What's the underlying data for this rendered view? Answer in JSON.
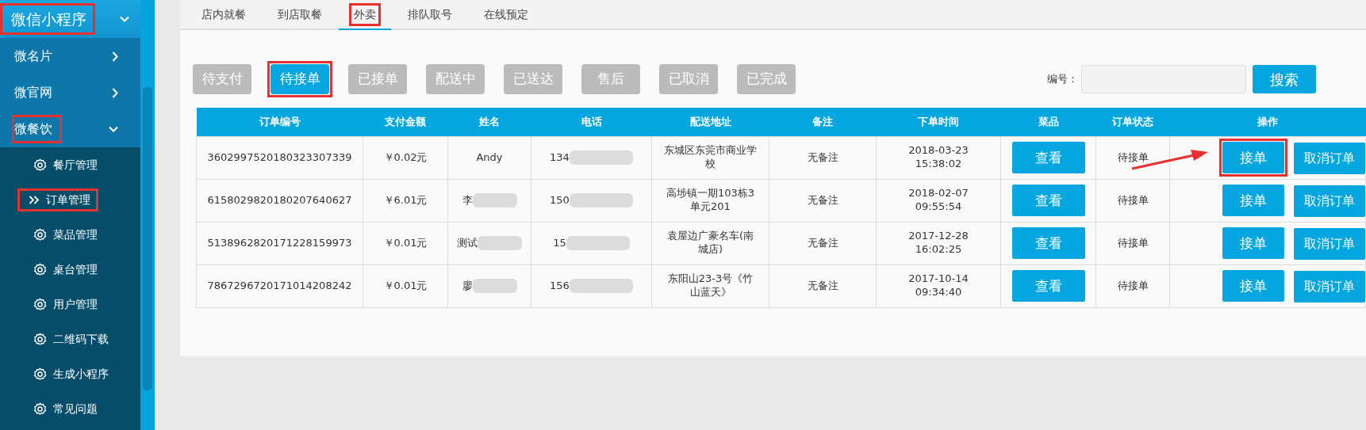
{
  "sidebar": {
    "header": {
      "label": "微信小程序",
      "highlighted": true
    },
    "items": [
      {
        "label": "微名片",
        "expanded": false,
        "highlighted": false
      },
      {
        "label": "微官网",
        "expanded": false,
        "highlighted": false
      },
      {
        "label": "微餐饮",
        "expanded": true,
        "highlighted": true,
        "children": [
          {
            "label": "餐厅管理",
            "selected": false,
            "highlighted": false
          },
          {
            "label": "订单管理",
            "selected": true,
            "highlighted": true
          },
          {
            "label": "菜品管理",
            "selected": false,
            "highlighted": false
          },
          {
            "label": "桌台管理",
            "selected": false,
            "highlighted": false
          },
          {
            "label": "用户管理",
            "selected": false,
            "highlighted": false
          },
          {
            "label": "二维码下载",
            "selected": false,
            "highlighted": false
          },
          {
            "label": "生成小程序",
            "selected": false,
            "highlighted": false
          },
          {
            "label": "常见问题",
            "selected": false,
            "highlighted": false
          }
        ]
      }
    ]
  },
  "tabs": [
    {
      "label": "店内就餐",
      "selected": false,
      "highlighted": false
    },
    {
      "label": "到店取餐",
      "selected": false,
      "highlighted": false
    },
    {
      "label": "外卖",
      "selected": true,
      "highlighted": true
    },
    {
      "label": "排队取号",
      "selected": false,
      "highlighted": false
    },
    {
      "label": "在线预定",
      "selected": false,
      "highlighted": false
    }
  ],
  "filters": [
    {
      "label": "待支付",
      "selected": false,
      "highlighted": false
    },
    {
      "label": "待接单",
      "selected": true,
      "highlighted": true
    },
    {
      "label": "已接单",
      "selected": false,
      "highlighted": false
    },
    {
      "label": "配送中",
      "selected": false,
      "highlighted": false
    },
    {
      "label": "已送达",
      "selected": false,
      "highlighted": false
    },
    {
      "label": "售后",
      "selected": false,
      "highlighted": false
    },
    {
      "label": "已取消",
      "selected": false,
      "highlighted": false
    },
    {
      "label": "已完成",
      "selected": false,
      "highlighted": false
    }
  ],
  "search": {
    "label": "编号：",
    "button": "搜索"
  },
  "table": {
    "columns": [
      "订单编号",
      "支付金额",
      "姓名",
      "电话",
      "配送地址",
      "备注",
      "下单时间",
      "菜品",
      "订单状态",
      "操作"
    ],
    "rows": [
      {
        "order_no": "3602997520180323307339",
        "amount": "￥0.02元",
        "name": "Andy",
        "name_redacted": false,
        "phone": "134",
        "phone_redacted": true,
        "address": "东城区东莞市商业学校",
        "note": "无备注",
        "date": "2018-03-23",
        "time": "15:38:02",
        "view_button": "查看",
        "status": "待接单",
        "accept_button": "接单",
        "accept_highlighted": true,
        "cancel_button": "取消订单",
        "pointer_arrow": true
      },
      {
        "order_no": "6158029820180207640627",
        "amount": "￥6.01元",
        "name": "李",
        "name_redacted": true,
        "phone": "150",
        "phone_redacted": true,
        "address": "高埗镇一期103栋3单元201",
        "note": "无备注",
        "date": "2018-02-07",
        "time": "09:55:54",
        "view_button": "查看",
        "status": "待接单",
        "accept_button": "接单",
        "accept_highlighted": false,
        "cancel_button": "取消订单",
        "pointer_arrow": false
      },
      {
        "order_no": "5138962820171228159973",
        "amount": "￥0.01元",
        "name": "测试",
        "name_redacted": true,
        "phone": "15",
        "phone_redacted": true,
        "address": "袁屋边广豪名车(南城店)",
        "note": "无备注",
        "date": "2017-12-28",
        "time": "16:02:25",
        "view_button": "查看",
        "status": "待接单",
        "accept_button": "接单",
        "accept_highlighted": false,
        "cancel_button": "取消订单",
        "pointer_arrow": false
      },
      {
        "order_no": "7867296720171014208242",
        "amount": "￥0.01元",
        "name": "廖",
        "name_redacted": true,
        "phone": "156",
        "phone_redacted": true,
        "address": "东阳山23-3号《竹山蓝天》",
        "note": "无备注",
        "date": "2017-10-14",
        "time": "09:34:40",
        "view_button": "查看",
        "status": "待接单",
        "accept_button": "接单",
        "accept_highlighted": false,
        "cancel_button": "取消订单",
        "pointer_arrow": false
      }
    ]
  }
}
